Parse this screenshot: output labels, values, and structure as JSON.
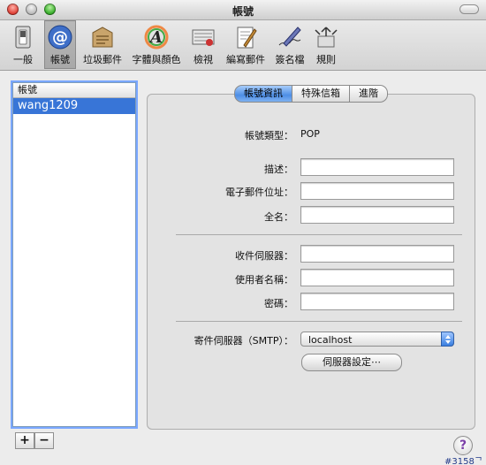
{
  "window": {
    "title": "帳號"
  },
  "toolbar": {
    "items": [
      {
        "label": "一般",
        "icon": "switch-icon"
      },
      {
        "label": "帳號",
        "icon": "at-sign-icon",
        "active": true
      },
      {
        "label": "垃圾郵件",
        "icon": "junk-mail-icon"
      },
      {
        "label": "字體與顏色",
        "icon": "font-color-icon"
      },
      {
        "label": "檢視",
        "icon": "view-icon"
      },
      {
        "label": "編寫郵件",
        "icon": "compose-icon"
      },
      {
        "label": "簽名檔",
        "icon": "signature-pen-icon"
      },
      {
        "label": "規則",
        "icon": "rules-icon"
      }
    ]
  },
  "accounts": {
    "header": "帳號",
    "items": [
      {
        "name": "wang1209",
        "selected": true
      }
    ]
  },
  "list_controls": {
    "add": "+",
    "remove": "−"
  },
  "tabs": [
    {
      "label": "帳號資訊",
      "active": true
    },
    {
      "label": "特殊信箱",
      "active": false
    },
    {
      "label": "進階",
      "active": false
    }
  ],
  "form": {
    "account_type_label": "帳號類型：",
    "account_type_value": "POP",
    "description_label": "描述：",
    "description_value": "",
    "email_label": "電子郵件位址：",
    "email_value": "",
    "fullname_label": "全名：",
    "fullname_value": "",
    "incoming_server_label": "收件伺服器：",
    "incoming_server_value": "",
    "username_label": "使用者名稱：",
    "username_value": "",
    "password_label": "密碼：",
    "password_value": "",
    "smtp_label": "寄件伺服器（SMTP）：",
    "smtp_value": "localhost",
    "server_settings_button": "伺服器設定⋯"
  },
  "help": {
    "label": "?"
  },
  "watermark": "#3158ᄀ",
  "colors": {
    "selection": "#3875d7",
    "tab_active": "#4d8ee6"
  }
}
